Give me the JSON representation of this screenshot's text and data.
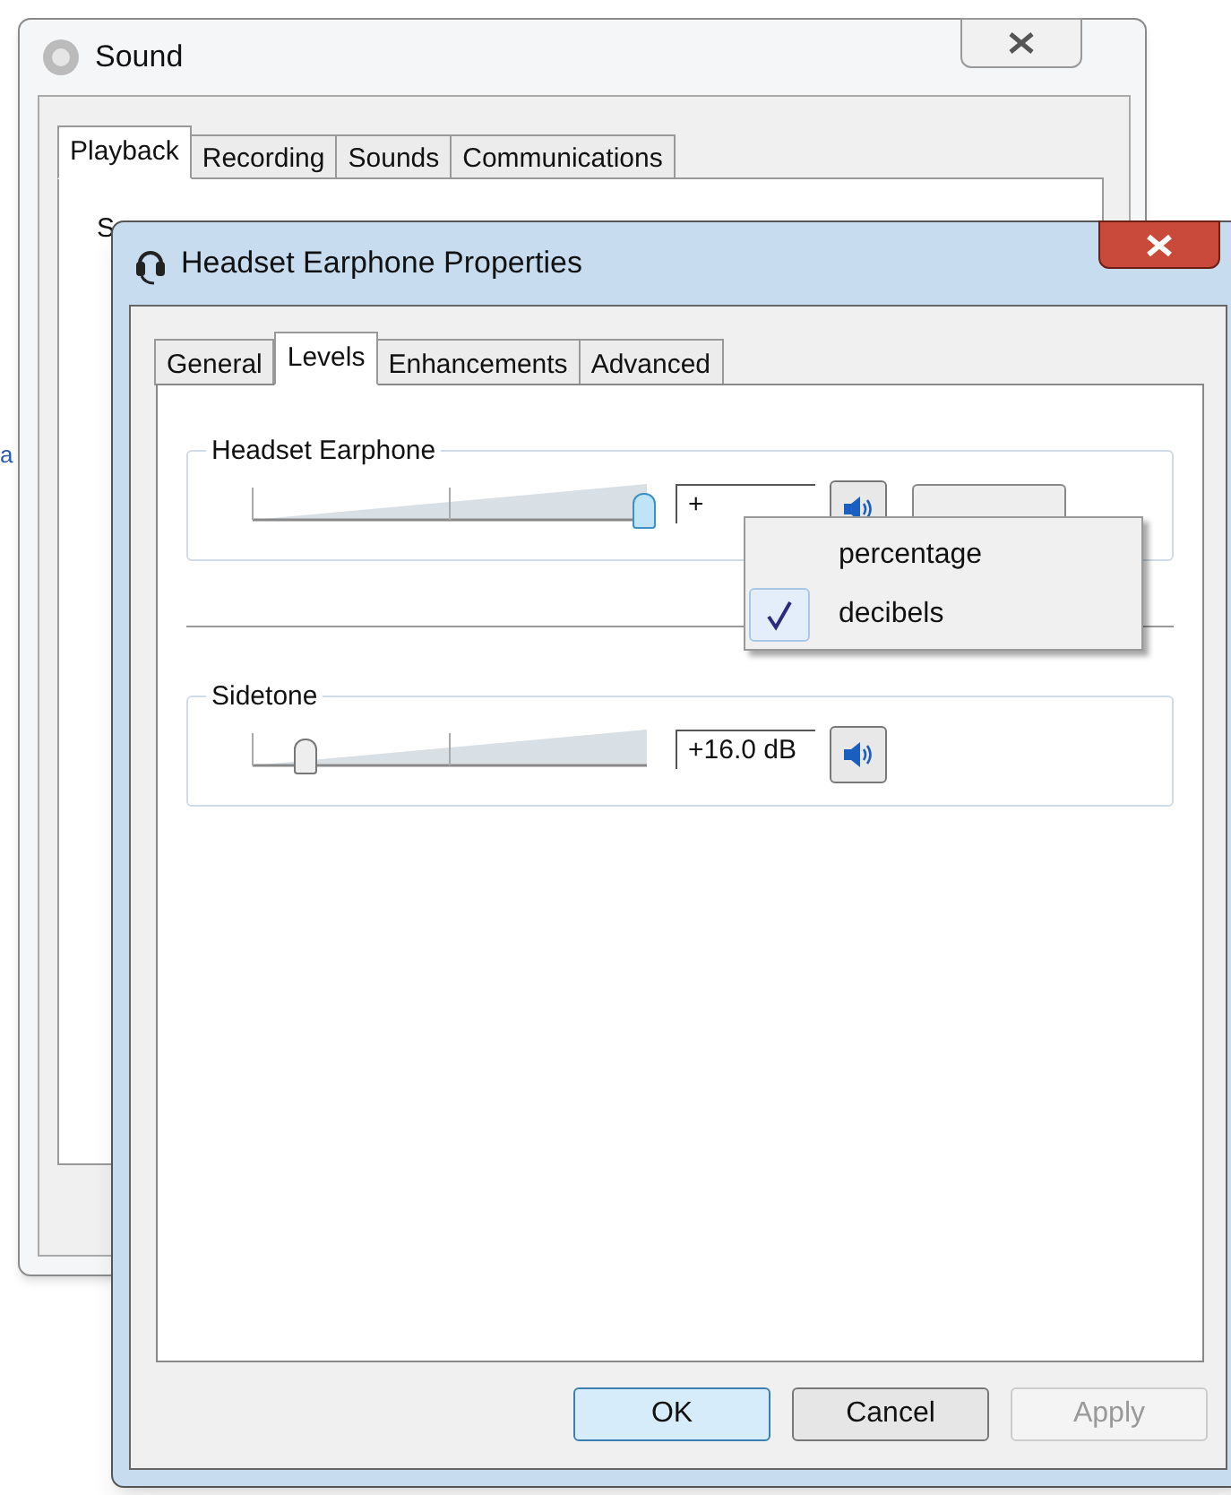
{
  "desktop_text": "a",
  "back_window": {
    "title": "Sound",
    "tabs": [
      {
        "label": "Playback",
        "selected": true
      },
      {
        "label": "Recording",
        "selected": false
      },
      {
        "label": "Sounds",
        "selected": false
      },
      {
        "label": "Communications",
        "selected": false
      }
    ],
    "partial_text": "S"
  },
  "window": {
    "title": "Headset Earphone Properties",
    "tabs": [
      {
        "label": "General",
        "selected": false
      },
      {
        "label": "Levels",
        "selected": true
      },
      {
        "label": "Enhancements",
        "selected": false
      },
      {
        "label": "Advanced",
        "selected": false
      }
    ],
    "channels": [
      {
        "name": "Headset Earphone",
        "level": 0.99,
        "reading": "+",
        "balance_button": true
      },
      {
        "name": "Sidetone",
        "level": 0.13,
        "reading": "+16.0 dB",
        "balance_button": false
      }
    ],
    "unit_menu": [
      {
        "label": "percentage",
        "checked": false
      },
      {
        "label": "decibels",
        "checked": true
      }
    ],
    "buttons": [
      {
        "label": "OK",
        "kind": "default",
        "disabled": false
      },
      {
        "label": "Cancel",
        "kind": "normal",
        "disabled": false
      },
      {
        "label": "Apply",
        "kind": "normal",
        "disabled": true
      }
    ]
  }
}
